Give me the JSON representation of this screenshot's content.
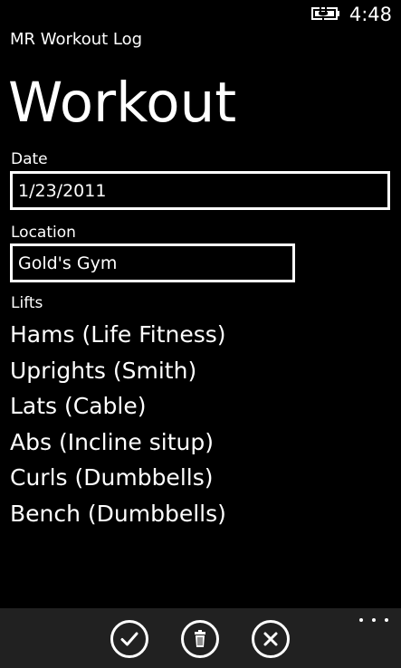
{
  "status_bar": {
    "time": "4:48",
    "battery_icon": "battery-charging-icon"
  },
  "app": {
    "title": "MR Workout Log"
  },
  "page": {
    "title": "Workout"
  },
  "form": {
    "date_label": "Date",
    "date_value": "1/23/2011",
    "location_label": "Location",
    "location_value": "Gold's Gym",
    "lifts_label": "Lifts"
  },
  "lifts": [
    "Hams (Life Fitness)",
    "Uprights (Smith)",
    "Lats (Cable)",
    "Abs (Incline situp)",
    "Curls (Dumbbells)",
    "Bench (Dumbbells)"
  ],
  "app_bar": {
    "buttons": [
      {
        "icon": "check-icon"
      },
      {
        "icon": "trash-icon"
      },
      {
        "icon": "close-icon"
      }
    ],
    "more_icon": "ellipsis-icon"
  },
  "colors": {
    "background": "#000000",
    "foreground": "#ffffff",
    "app_bar": "#212121"
  }
}
